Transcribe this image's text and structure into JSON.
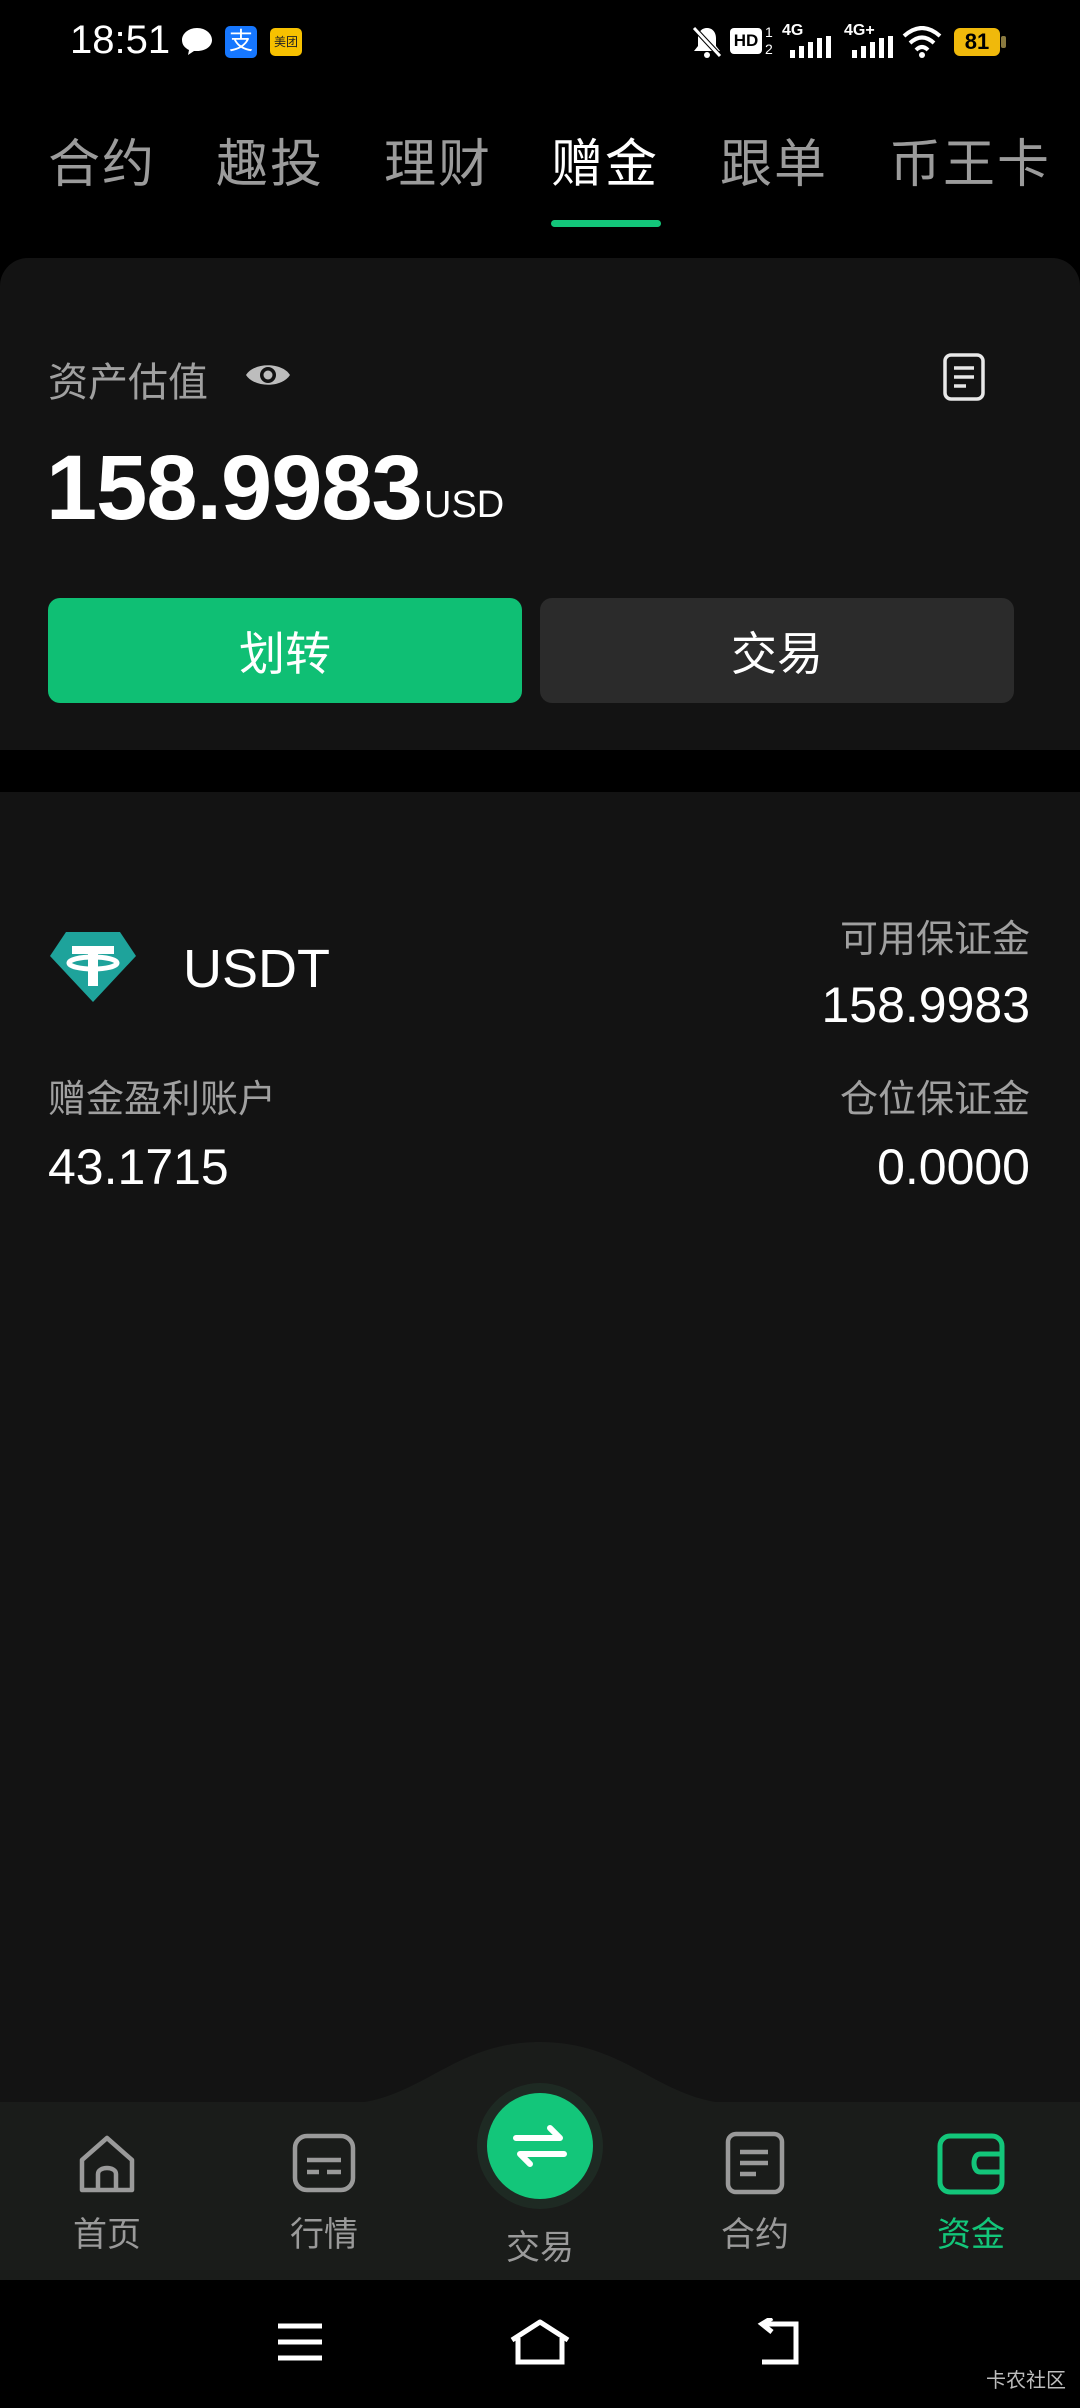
{
  "status_bar": {
    "time": "18:51",
    "icons": [
      "message-icon",
      "alipay-icon",
      "meituan-icon",
      "mute-icon",
      "hd-icon",
      "signal-4g-icon",
      "signal-4g-plus-icon",
      "wifi-icon"
    ],
    "alipay_glyph": "支",
    "meituan_text": "美团",
    "hd_text": "HD",
    "net1": "4G",
    "net2": "4G+",
    "battery": "81"
  },
  "tabs": [
    {
      "label": "合约"
    },
    {
      "label": "趣投"
    },
    {
      "label": "理财"
    },
    {
      "label": "赠金"
    },
    {
      "label": "跟单"
    },
    {
      "label": "币王卡"
    }
  ],
  "active_tab": "赠金",
  "asset": {
    "label": "资产估值",
    "value": "158.9983",
    "unit": "USD",
    "transfer_label": "划转",
    "trade_label": "交易"
  },
  "account": {
    "coin": "USDT",
    "available_label": "可用保证金",
    "available_value": "158.9983",
    "profit_label": "赠金盈利账户",
    "profit_value": "43.1715",
    "position_label": "仓位保证金",
    "position_value": "0.0000"
  },
  "bottom_nav": [
    {
      "label": "首页",
      "icon": "home-icon"
    },
    {
      "label": "行情",
      "icon": "market-icon"
    },
    {
      "label": "交易",
      "icon": "swap-icon"
    },
    {
      "label": "合约",
      "icon": "contract-icon"
    },
    {
      "label": "资金",
      "icon": "wallet-icon"
    }
  ],
  "watermark": "卡农社区",
  "colors": {
    "accent": "#13c67a",
    "background": "#131313",
    "battery": "#f0b90b",
    "usdt": "#26a17b"
  }
}
